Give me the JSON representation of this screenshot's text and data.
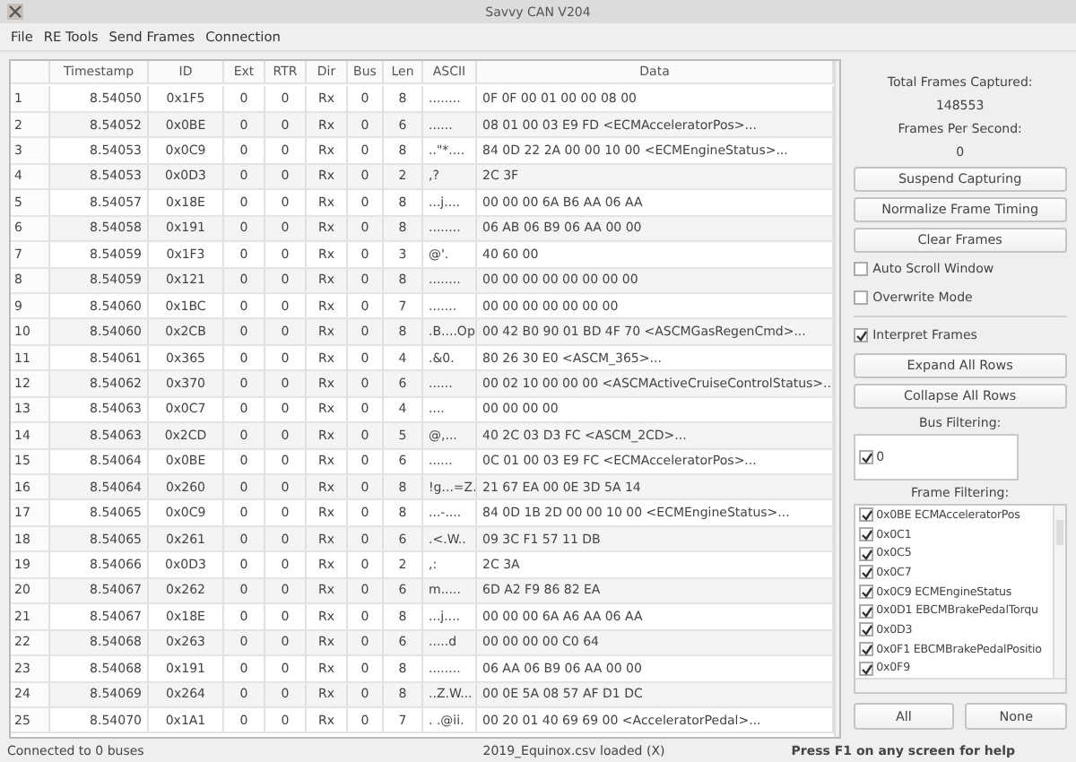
{
  "window": {
    "title": "Savvy CAN V204"
  },
  "menu": [
    "File",
    "RE Tools",
    "Send Frames",
    "Connection"
  ],
  "table": {
    "columns": [
      "Timestamp",
      "ID",
      "Ext",
      "RTR",
      "Dir",
      "Bus",
      "Len",
      "ASCII",
      "Data"
    ],
    "rows": [
      {
        "n": "1",
        "ts": "8.54050",
        "id": "0x1F5",
        "ext": "0",
        "rtr": "0",
        "dir": "Rx",
        "bus": "0",
        "len": "8",
        "ascii": "........",
        "data": "0F 0F 00 01 00 00 08 00"
      },
      {
        "n": "2",
        "ts": "8.54052",
        "id": "0x0BE",
        "ext": "0",
        "rtr": "0",
        "dir": "Rx",
        "bus": "0",
        "len": "6",
        "ascii": "......",
        "data": "08 01 00 03 E9 FD    <ECMAcceleratorPos>..."
      },
      {
        "n": "3",
        "ts": "8.54053",
        "id": "0x0C9",
        "ext": "0",
        "rtr": "0",
        "dir": "Rx",
        "bus": "0",
        "len": "8",
        "ascii": "..\"*....",
        "data": "84 0D 22 2A 00 00 10 00    <ECMEngineStatus>..."
      },
      {
        "n": "4",
        "ts": "8.54053",
        "id": "0x0D3",
        "ext": "0",
        "rtr": "0",
        "dir": "Rx",
        "bus": "0",
        "len": "2",
        "ascii": ",?",
        "data": "2C 3F"
      },
      {
        "n": "5",
        "ts": "8.54057",
        "id": "0x18E",
        "ext": "0",
        "rtr": "0",
        "dir": "Rx",
        "bus": "0",
        "len": "8",
        "ascii": "...j....",
        "data": "00 00 00 6A B6 AA 06 AA"
      },
      {
        "n": "6",
        "ts": "8.54058",
        "id": "0x191",
        "ext": "0",
        "rtr": "0",
        "dir": "Rx",
        "bus": "0",
        "len": "8",
        "ascii": "........",
        "data": "06 AB 06 B9 06 AA 00 00"
      },
      {
        "n": "7",
        "ts": "8.54059",
        "id": "0x1F3",
        "ext": "0",
        "rtr": "0",
        "dir": "Rx",
        "bus": "0",
        "len": "3",
        "ascii": "@'.",
        "data": "40 60 00"
      },
      {
        "n": "8",
        "ts": "8.54059",
        "id": "0x121",
        "ext": "0",
        "rtr": "0",
        "dir": "Rx",
        "bus": "0",
        "len": "8",
        "ascii": "........",
        "data": "00 00 00 00 00 00 00 00"
      },
      {
        "n": "9",
        "ts": "8.54060",
        "id": "0x1BC",
        "ext": "0",
        "rtr": "0",
        "dir": "Rx",
        "bus": "0",
        "len": "7",
        "ascii": ".......",
        "data": "00 00 00 00 00 00 00"
      },
      {
        "n": "10",
        "ts": "8.54060",
        "id": "0x2CB",
        "ext": "0",
        "rtr": "0",
        "dir": "Rx",
        "bus": "0",
        "len": "8",
        "ascii": ".B....Op",
        "data": "00 42 B0 90 01 BD 4F 70    <ASCMGasRegenCmd>..."
      },
      {
        "n": "11",
        "ts": "8.54061",
        "id": "0x365",
        "ext": "0",
        "rtr": "0",
        "dir": "Rx",
        "bus": "0",
        "len": "4",
        "ascii": ".&0.",
        "data": "80 26 30 E0    <ASCM_365>..."
      },
      {
        "n": "12",
        "ts": "8.54062",
        "id": "0x370",
        "ext": "0",
        "rtr": "0",
        "dir": "Rx",
        "bus": "0",
        "len": "6",
        "ascii": "......",
        "data": "00 02 10 00 00 00    <ASCMActiveCruiseControlStatus>..."
      },
      {
        "n": "13",
        "ts": "8.54063",
        "id": "0x0C7",
        "ext": "0",
        "rtr": "0",
        "dir": "Rx",
        "bus": "0",
        "len": "4",
        "ascii": "....",
        "data": "00 00 00 00"
      },
      {
        "n": "14",
        "ts": "8.54063",
        "id": "0x2CD",
        "ext": "0",
        "rtr": "0",
        "dir": "Rx",
        "bus": "0",
        "len": "5",
        "ascii": "@,...",
        "data": "40 2C 03 D3 FC    <ASCM_2CD>..."
      },
      {
        "n": "15",
        "ts": "8.54064",
        "id": "0x0BE",
        "ext": "0",
        "rtr": "0",
        "dir": "Rx",
        "bus": "0",
        "len": "6",
        "ascii": "......",
        "data": "0C 01 00 03 E9 FC    <ECMAcceleratorPos>..."
      },
      {
        "n": "16",
        "ts": "8.54064",
        "id": "0x260",
        "ext": "0",
        "rtr": "0",
        "dir": "Rx",
        "bus": "0",
        "len": "8",
        "ascii": "!g...=Z.",
        "data": "21 67 EA 00 0E 3D 5A 14"
      },
      {
        "n": "17",
        "ts": "8.54065",
        "id": "0x0C9",
        "ext": "0",
        "rtr": "0",
        "dir": "Rx",
        "bus": "0",
        "len": "8",
        "ascii": "...-....",
        "data": "84 0D 1B 2D 00 00 10 00    <ECMEngineStatus>..."
      },
      {
        "n": "18",
        "ts": "8.54065",
        "id": "0x261",
        "ext": "0",
        "rtr": "0",
        "dir": "Rx",
        "bus": "0",
        "len": "6",
        "ascii": ".<.W..",
        "data": "09 3C F1 57 11 DB"
      },
      {
        "n": "19",
        "ts": "8.54066",
        "id": "0x0D3",
        "ext": "0",
        "rtr": "0",
        "dir": "Rx",
        "bus": "0",
        "len": "2",
        "ascii": ",:",
        "data": "2C 3A"
      },
      {
        "n": "20",
        "ts": "8.54067",
        "id": "0x262",
        "ext": "0",
        "rtr": "0",
        "dir": "Rx",
        "bus": "0",
        "len": "6",
        "ascii": "m.....",
        "data": "6D A2 F9 86 82 EA"
      },
      {
        "n": "21",
        "ts": "8.54067",
        "id": "0x18E",
        "ext": "0",
        "rtr": "0",
        "dir": "Rx",
        "bus": "0",
        "len": "8",
        "ascii": "...j....",
        "data": "00 00 00 6A A6 AA 06 AA"
      },
      {
        "n": "22",
        "ts": "8.54068",
        "id": "0x263",
        "ext": "0",
        "rtr": "0",
        "dir": "Rx",
        "bus": "0",
        "len": "6",
        "ascii": ".....d",
        "data": "00 00 00 00 C0 64"
      },
      {
        "n": "23",
        "ts": "8.54068",
        "id": "0x191",
        "ext": "0",
        "rtr": "0",
        "dir": "Rx",
        "bus": "0",
        "len": "8",
        "ascii": "........",
        "data": "06 AA 06 B9 06 AA 00 00"
      },
      {
        "n": "24",
        "ts": "8.54069",
        "id": "0x264",
        "ext": "0",
        "rtr": "0",
        "dir": "Rx",
        "bus": "0",
        "len": "8",
        "ascii": "..Z.W...",
        "data": "00 0E 5A 08 57 AF D1 DC"
      },
      {
        "n": "25",
        "ts": "8.54070",
        "id": "0x1A1",
        "ext": "0",
        "rtr": "0",
        "dir": "Rx",
        "bus": "0",
        "len": "7",
        "ascii": ". .@ii.",
        "data": "00 20 01 40 69 69 00    <AcceleratorPedal>..."
      }
    ]
  },
  "side": {
    "total_label": "Total Frames Captured:",
    "total": "148553",
    "fps_label": "Frames Per Second:",
    "fps": "0",
    "buttons1": [
      "Suspend Capturing",
      "Normalize Frame Timing",
      "Clear Frames"
    ],
    "options": [
      {
        "label": "Auto Scroll Window",
        "checked": false
      },
      {
        "label": "Overwrite Mode",
        "checked": false
      }
    ],
    "interpret": {
      "label": "Interpret Frames",
      "checked": true
    },
    "buttons2": [
      "Expand All Rows",
      "Collapse All Rows"
    ],
    "bus_label": "Bus Filtering:",
    "buses": [
      {
        "label": "0",
        "checked": true
      }
    ],
    "frame_label": "Frame Filtering:",
    "frames": [
      {
        "label": "0x0BE ECMAcceleratorPos",
        "checked": true
      },
      {
        "label": "0x0C1",
        "checked": true
      },
      {
        "label": "0x0C5",
        "checked": true
      },
      {
        "label": "0x0C7",
        "checked": true
      },
      {
        "label": "0x0C9 ECMEngineStatus",
        "checked": true
      },
      {
        "label": "0x0D1 EBCMBrakePedalTorqu",
        "checked": true
      },
      {
        "label": "0x0D3",
        "checked": true
      },
      {
        "label": "0x0F1 EBCMBrakePedalPositio",
        "checked": true
      },
      {
        "label": "0x0F9",
        "checked": true
      }
    ],
    "filter_buttons": [
      "All",
      "None"
    ]
  },
  "status_bar": {
    "left": "Connected to 0 buses",
    "center": "2019_Equinox.csv loaded (X)",
    "right": "Press F1 on any screen for help"
  }
}
